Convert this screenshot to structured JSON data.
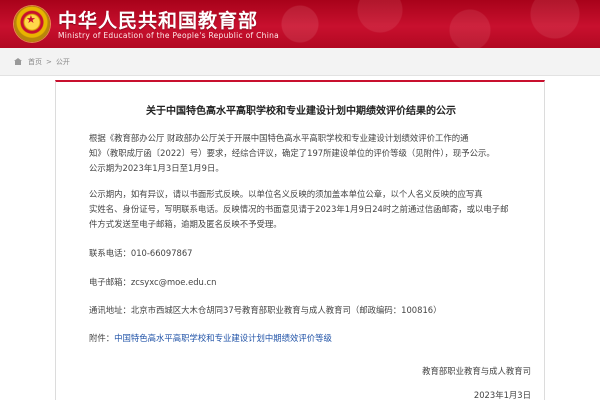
{
  "header": {
    "title_cn": "中华人民共和国教育部",
    "title_en": "Ministry of Education of the People's Republic of China",
    "emblem_icon": "national-emblem-icon",
    "brand_color": "#c8102e"
  },
  "breadcrumb": {
    "items": [
      "首页",
      "公开"
    ]
  },
  "article": {
    "title": "关于中国特色高水平高职学校和专业建设计划中期绩效评价结果的公示",
    "para1_lines": [
      "根据《教育部办公厅 财政部办公厅关于开展中国特色高水平高职学校和专业建设计划绩效评价工作的通",
      "知》（教职成厅函〔2022〕号）要求，经综合评议，确定了197所建设单位的评价等级（见附件），现予公示。",
      "公示期为2023年1月3日至1月9日。"
    ],
    "para2_lines": [
      "公示期内，如有异议，请以书面形式反映。以单位名义反映的须加盖本单位公章，以个人名义反映的应写真",
      "实姓名、身份证号，写明联系电话。反映情况的书面意见请于2023年1月9日24时之前通过信函邮寄，或以电子邮",
      "件方式发送至电子邮箱，逾期及匿名反映不予受理。"
    ],
    "phone_label": "联系电话：",
    "phone_value": "010-66097867",
    "email_label": "电子邮箱：",
    "email_value": "zcsyxc@moe.edu.cn",
    "address_label": "通讯地址：",
    "address_value": "北京市西城区大木仓胡同37号教育部职业教育与成人教育司（邮政编码：100816）",
    "attachment_label": "附件：",
    "attachment_link": "中国特色高水平高职学校和专业建设计划中期绩效评价等级",
    "signature": "教育部职业教育与成人教育司",
    "date": "2023年1月3日"
  }
}
